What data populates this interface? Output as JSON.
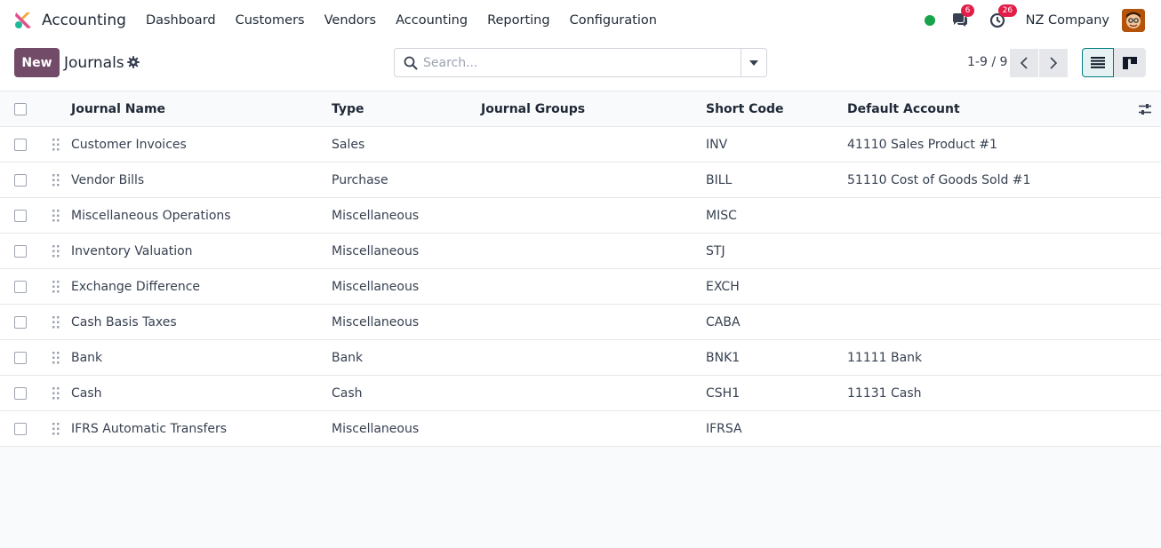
{
  "app": {
    "name": "Accounting"
  },
  "menu": [
    "Dashboard",
    "Customers",
    "Vendors",
    "Accounting",
    "Reporting",
    "Configuration"
  ],
  "nav": {
    "messages_count": "6",
    "activities_count": "26",
    "company": "NZ Company"
  },
  "control": {
    "new_label": "New",
    "title": "Journals",
    "search_placeholder": "Search...",
    "pager": "1-9 / 9"
  },
  "table": {
    "headers": {
      "name": "Journal Name",
      "type": "Type",
      "groups": "Journal Groups",
      "code": "Short Code",
      "account": "Default Account"
    },
    "rows": [
      {
        "name": "Customer Invoices",
        "type": "Sales",
        "groups": "",
        "code": "INV",
        "account": "41110 Sales Product #1"
      },
      {
        "name": "Vendor Bills",
        "type": "Purchase",
        "groups": "",
        "code": "BILL",
        "account": "51110 Cost of Goods Sold #1"
      },
      {
        "name": "Miscellaneous Operations",
        "type": "Miscellaneous",
        "groups": "",
        "code": "MISC",
        "account": ""
      },
      {
        "name": "Inventory Valuation",
        "type": "Miscellaneous",
        "groups": "",
        "code": "STJ",
        "account": ""
      },
      {
        "name": "Exchange Difference",
        "type": "Miscellaneous",
        "groups": "",
        "code": "EXCH",
        "account": ""
      },
      {
        "name": "Cash Basis Taxes",
        "type": "Miscellaneous",
        "groups": "",
        "code": "CABA",
        "account": ""
      },
      {
        "name": "Bank",
        "type": "Bank",
        "groups": "",
        "code": "BNK1",
        "account": "11111 Bank"
      },
      {
        "name": "Cash",
        "type": "Cash",
        "groups": "",
        "code": "CSH1",
        "account": "11131 Cash"
      },
      {
        "name": "IFRS Automatic Transfers",
        "type": "Miscellaneous",
        "groups": "",
        "code": "IFRSA",
        "account": ""
      }
    ]
  },
  "colors": {
    "brand": "#714b67",
    "accent": "#017e84",
    "badge": "#e11d48",
    "online": "#16a34a"
  }
}
